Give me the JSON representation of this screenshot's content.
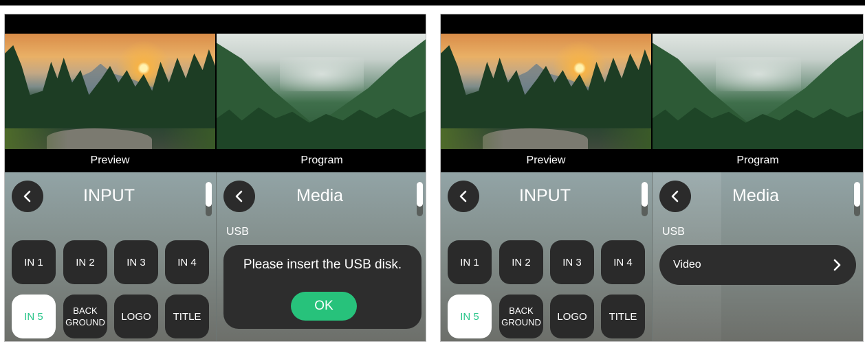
{
  "screens": [
    {
      "preview_label": "Preview",
      "program_label": "Program",
      "input_panel": {
        "title": "INPUT",
        "buttons": [
          {
            "label": "IN 1",
            "active": false
          },
          {
            "label": "IN 2",
            "active": false
          },
          {
            "label": "IN 3",
            "active": false
          },
          {
            "label": "IN 4",
            "active": false
          },
          {
            "label": "IN 5",
            "active": true
          },
          {
            "label": "BACK GROUND",
            "active": false
          },
          {
            "label": "LOGO",
            "active": false
          },
          {
            "label": "TITLE",
            "active": false
          }
        ]
      },
      "media_panel": {
        "title": "Media",
        "section_label": "USB",
        "dialog": {
          "message": "Please insert the USB disk.",
          "ok_label": "OK"
        }
      }
    },
    {
      "preview_label": "Preview",
      "program_label": "Program",
      "input_panel": {
        "title": "INPUT",
        "buttons": [
          {
            "label": "IN 1",
            "active": false
          },
          {
            "label": "IN 2",
            "active": false
          },
          {
            "label": "IN 3",
            "active": false
          },
          {
            "label": "IN 4",
            "active": false
          },
          {
            "label": "IN 5",
            "active": true
          },
          {
            "label": "BACK GROUND",
            "active": false
          },
          {
            "label": "LOGO",
            "active": false
          },
          {
            "label": "TITLE",
            "active": false
          }
        ]
      },
      "media_panel": {
        "title": "Media",
        "section_label": "USB",
        "list_items": [
          {
            "label": "Video"
          }
        ]
      }
    }
  ],
  "icons": {
    "back": "chevron-left-icon",
    "row_arrow": "chevron-right-icon"
  },
  "colors": {
    "accent_green": "#27c27b",
    "active_text": "#29c58a",
    "button_dark": "#2a2a2a"
  }
}
